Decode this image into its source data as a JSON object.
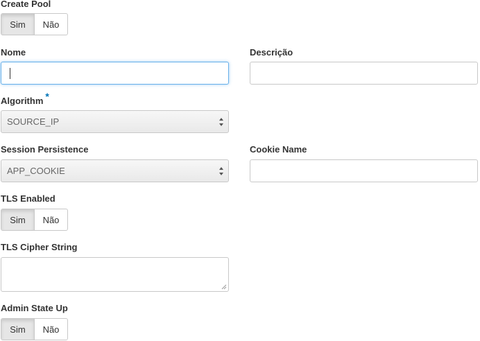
{
  "create_pool": {
    "label": "Create Pool",
    "options": [
      "Sim",
      "Não"
    ],
    "selected": "Sim"
  },
  "nome": {
    "label": "Nome",
    "value": ""
  },
  "descricao": {
    "label": "Descrição",
    "value": ""
  },
  "algorithm": {
    "label": "Algorithm",
    "required_marker": "*",
    "selected": "SOURCE_IP"
  },
  "session_persistence": {
    "label": "Session Persistence",
    "selected": "APP_COOKIE"
  },
  "cookie_name": {
    "label": "Cookie Name",
    "value": ""
  },
  "tls_enabled": {
    "label": "TLS Enabled",
    "options": [
      "Sim",
      "Não"
    ],
    "selected": "Sim"
  },
  "tls_cipher_string": {
    "label": "TLS Cipher String",
    "value": ""
  },
  "admin_state_up": {
    "label": "Admin State Up",
    "options": [
      "Sim",
      "Não"
    ],
    "selected": "Sim"
  },
  "colors": {
    "focus_border": "#66afe9",
    "required": "#0073b7",
    "active_toggle": "#e6e6e6"
  },
  "icons": {
    "select_arrows": "up-down-arrows-icon",
    "resize_handle": "resize-grip-icon"
  }
}
